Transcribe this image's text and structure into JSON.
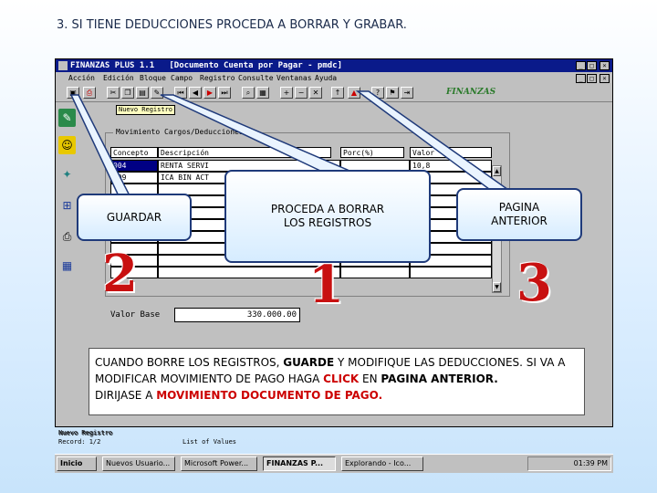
{
  "slide": {
    "heading": "3. SI TIENE DEDUCCIONES PROCEDA A BORRAR Y GRABAR."
  },
  "window": {
    "title": "FINANZAS PLUS 1.1   [Documento Cuenta por Pagar - pmdc]",
    "controls": [
      "_",
      "□",
      "×"
    ],
    "menu": [
      "Acción",
      "Edición",
      "Bloque",
      "Campo",
      "Registro",
      "Consulte",
      "Ventanas",
      "Ayuda"
    ],
    "brand": "FINANZAS"
  },
  "form": {
    "tooltip": "Nuevo Registro",
    "section_title": "Movimiento Cargos/Deducciones",
    "columns": [
      "Concepto",
      "Descripción",
      "Porc(%)",
      "Valor"
    ],
    "rows": [
      {
        "code": "004",
        "desc": "RENTA SERVI",
        "valor": "10,8"
      },
      {
        "code": "009",
        "desc": "ICA BIN ACT",
        "valor": "3,"
      },
      {
        "code": "",
        "desc": "",
        "valor": ""
      },
      {
        "code": "",
        "desc": "",
        "valor": ""
      },
      {
        "code": "",
        "desc": "",
        "valor": ""
      },
      {
        "code": "",
        "desc": "",
        "valor": ""
      },
      {
        "code": "",
        "desc": "",
        "valor": ""
      },
      {
        "code": "",
        "desc": "",
        "valor": ""
      },
      {
        "code": "",
        "desc": "",
        "valor": ""
      },
      {
        "code": "",
        "desc": "",
        "valor": ""
      }
    ],
    "valor_base_label": "Valor Base",
    "valor_base_value": "330.000.00"
  },
  "status": {
    "line1": "Nuevo Registro",
    "line2": "Record: 1/2",
    "line3": "List of Values"
  },
  "taskbar": {
    "start": "Inicio",
    "tasks": [
      "Nuevos Usuario...",
      "Microsoft Power...",
      "FINANZAS P...",
      "Explorando - Ico..."
    ],
    "clock": "01:39 PM"
  },
  "callouts": {
    "guardar": "GUARDAR",
    "borrar_1": "PROCEDA A BORRAR",
    "borrar_2": "LOS REGISTROS",
    "pagina_1": "PAGINA",
    "pagina_2": "ANTERIOR"
  },
  "step_numbers": [
    "2",
    "1",
    "3"
  ],
  "note": {
    "p1": "CUANDO BORRE LOS REGISTROS, ",
    "guarde": "GUARDE",
    "p2": " Y MODIFIQUE LAS DEDUCCIONES. SI VA A MODIFICAR MOVIMIENTO DE PAGO HAGA ",
    "click": "CLICK",
    "p3": " EN ",
    "pagina": "PAGINA ANTERIOR.",
    "p4": " DIRIJASE A ",
    "mov": "MOVIMIENTO DOCUMENTO DE PAGO."
  },
  "colors": {
    "title_bar": "#0a1a8a",
    "accent_red": "#c81010",
    "callout_border": "#1f3a7a"
  }
}
